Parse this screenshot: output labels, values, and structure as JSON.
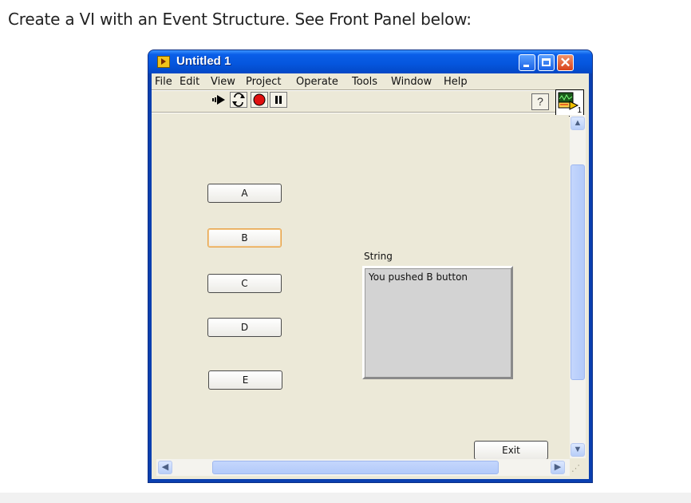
{
  "instruction": "Create a VI with an Event Structure. See Front Panel below:",
  "window": {
    "title": "Untitled 1",
    "controls": {
      "minimize": "minimize",
      "maximize": "maximize",
      "close": "close"
    }
  },
  "menu": [
    "File",
    "Edit",
    "View",
    "Project",
    "Operate",
    "Tools",
    "Window",
    "Help"
  ],
  "toolbar": {
    "buttons": [
      "run-arrow-icon",
      "run-continuously-icon",
      "abort-icon",
      "pause-icon"
    ],
    "help": "?"
  },
  "vi_icon_badge": "1",
  "front_panel": {
    "buttons": [
      {
        "label": "A",
        "active": false
      },
      {
        "label": "B",
        "active": true
      },
      {
        "label": "C",
        "active": false
      },
      {
        "label": "D",
        "active": false
      },
      {
        "label": "E",
        "active": false
      }
    ],
    "string_indicator": {
      "label": "String",
      "value": "You pushed B button"
    },
    "exit_label": "Exit"
  },
  "colors": {
    "titlebar": "#0556dd",
    "panel_bg": "#ece9d8",
    "active_button_border": "#e8a24a",
    "string_bg": "#d3d3d3"
  }
}
